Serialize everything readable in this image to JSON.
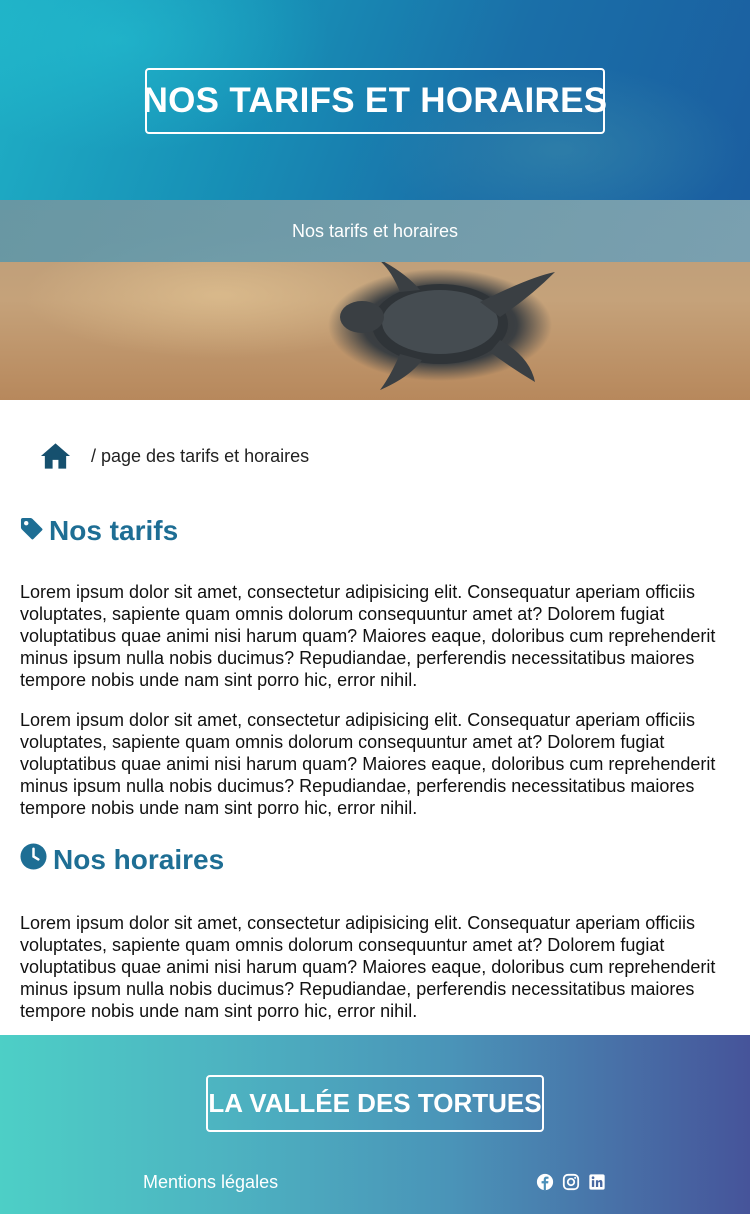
{
  "header": {
    "title": "NOS TARIFS ET HORAIRES",
    "subtitle": "Nos tarifs et horaires"
  },
  "breadcrumb": {
    "home_icon": "home-icon",
    "current": "/ page des tarifs et horaires"
  },
  "sections": {
    "tarifs": {
      "icon": "tag-icon",
      "title": "Nos tarifs",
      "paragraphs": [
        "Lorem ipsum dolor sit amet, consectetur adipisicing elit. Consequatur aperiam officiis voluptates, sapiente quam omnis dolorum consequuntur amet at? Dolorem fugiat voluptatibus quae animi nisi harum quam? Maiores eaque, doloribus cum reprehenderit minus ipsum nulla nobis ducimus? Repudiandae, perferendis necessitatibus maiores tempore nobis unde nam sint porro hic, error nihil.",
        "Lorem ipsum dolor sit amet, consectetur adipisicing elit. Consequatur aperiam officiis voluptates, sapiente quam omnis dolorum consequuntur amet at? Dolorem fugiat voluptatibus quae animi nisi harum quam? Maiores eaque, doloribus cum reprehenderit minus ipsum nulla nobis ducimus? Repudiandae, perferendis necessitatibus maiores tempore nobis unde nam sint porro hic, error nihil."
      ]
    },
    "horaires": {
      "icon": "clock-icon",
      "title": "Nos horaires",
      "paragraphs": [
        "Lorem ipsum dolor sit amet, consectetur adipisicing elit. Consequatur aperiam officiis voluptates, sapiente quam omnis dolorum consequuntur amet at? Dolorem fugiat voluptatibus quae animi nisi harum quam? Maiores eaque, doloribus cum reprehenderit minus ipsum nulla nobis ducimus? Repudiandae, perferendis necessitatibus maiores tempore nobis unde nam sint porro hic, error nihil."
      ]
    }
  },
  "footer": {
    "title": "LA VALLÉE DES TORTUES",
    "legal_link": "Mentions légales",
    "social_icons": [
      "facebook-icon",
      "instagram-icon",
      "linkedin-icon"
    ]
  },
  "colors": {
    "heading": "#1e6e94",
    "home_icon": "#16506e",
    "footer_start": "#4dcfc6",
    "footer_end": "#46549a"
  }
}
